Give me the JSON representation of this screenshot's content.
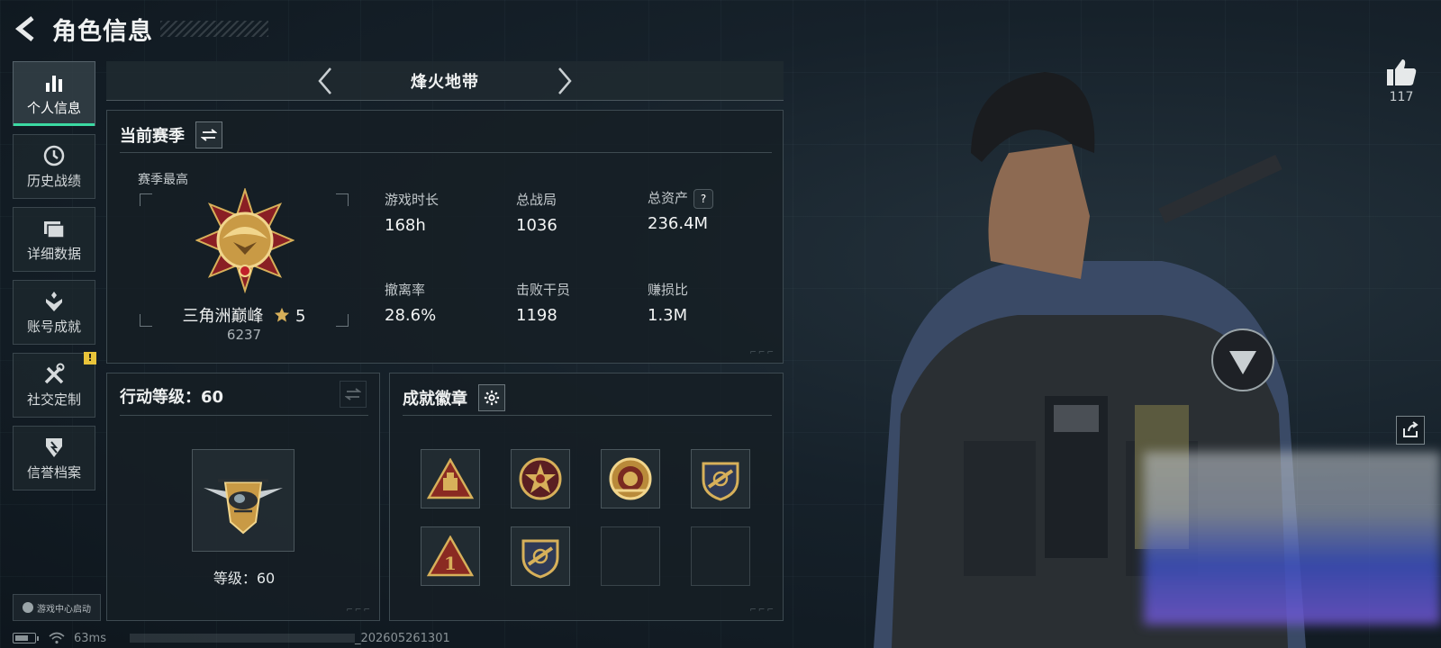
{
  "header": {
    "title": "角色信息"
  },
  "sidebar": {
    "items": [
      {
        "label": "个人信息",
        "icon": "bar-chart-icon",
        "active": true
      },
      {
        "label": "历史战绩",
        "icon": "history-clock-icon"
      },
      {
        "label": "详细数据",
        "icon": "folders-icon"
      },
      {
        "label": "账号成就",
        "icon": "achievement-emblem-icon"
      },
      {
        "label": "社交定制",
        "icon": "tools-icon",
        "badge": "!"
      },
      {
        "label": "信誉档案",
        "icon": "reputation-shield-icon"
      }
    ],
    "launch": "游戏中心启动"
  },
  "map_selector": {
    "name": "烽火地带"
  },
  "season": {
    "title": "当前赛季",
    "best_label": "赛季最高",
    "rank_name": "三角洲巅峰",
    "rank_stars": "5",
    "rank_score": "6237",
    "stats": [
      {
        "label": "游戏时长",
        "value": "168h"
      },
      {
        "label": "总战局",
        "value": "1036"
      },
      {
        "label": "总资产",
        "value": "236.4M",
        "help": "?"
      },
      {
        "label": "撤离率",
        "value": "28.6%"
      },
      {
        "label": "击败干员",
        "value": "1198"
      },
      {
        "label": "赚损比",
        "value": "1.3M"
      }
    ]
  },
  "action_level": {
    "title": "行动等级：60",
    "level_text": "等级：60"
  },
  "achievements": {
    "title": "成就徽章",
    "badges": [
      "triangle-supply-badge",
      "star-ring-badge",
      "flower-ring-badge",
      "shield-wing-badge",
      "triangle-number-badge",
      "shield-wing-badge-2",
      "empty",
      "empty"
    ],
    "triangle_number": "1"
  },
  "status_bar": {
    "ping": "63ms",
    "build": "_202605261301"
  },
  "like": {
    "count": "117"
  },
  "colors": {
    "accent": "#3bd9a2",
    "warning": "#e9c43a",
    "gold": "#d7b05a"
  }
}
